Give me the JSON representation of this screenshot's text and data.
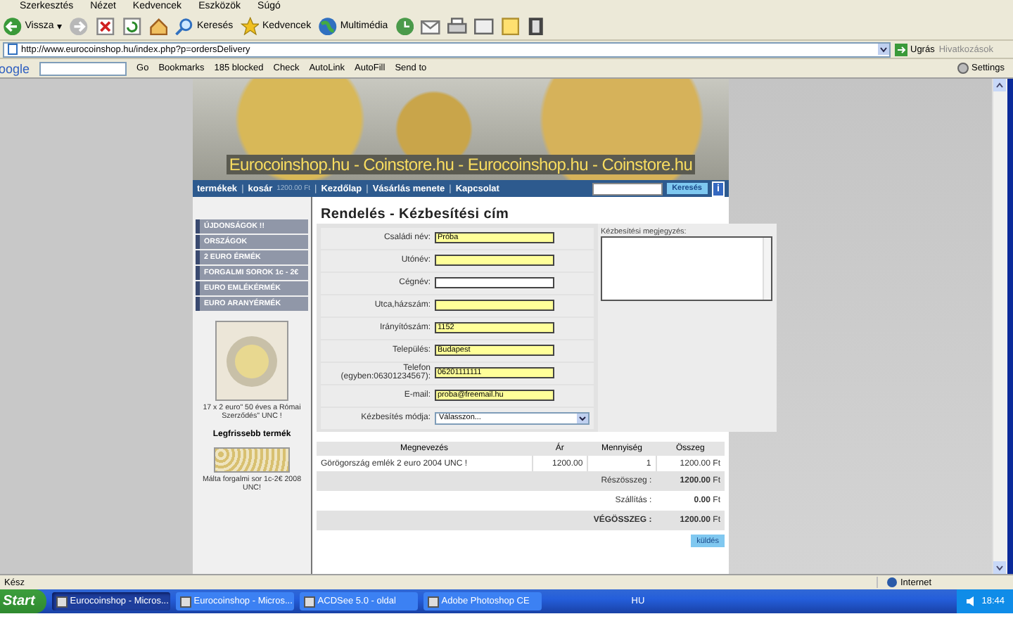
{
  "menu_bar": {
    "items": [
      "Szerkesztés",
      "Nézet",
      "Kedvencek",
      "Eszközök",
      "Súgó"
    ]
  },
  "toolbar": {
    "back_label": "Vissza",
    "back_menu": "▾",
    "search_label": "Keresés",
    "favorites_label": "Kedvencek",
    "media_label": "Multimédia"
  },
  "address_bar": {
    "url": "http://www.eurocoinshop.hu/index.php?p=ordersDelivery",
    "go_label": "Ugrás",
    "links_label": "Hivatkozások"
  },
  "google_bar": {
    "logo": "oogle",
    "go_label": "Go",
    "items": [
      "Bookmarks",
      "185 blocked",
      "Check",
      "AutoLink",
      "AutoFill",
      "Send to"
    ],
    "settings_label": "Settings"
  },
  "banner": {
    "text": "Eurocoinshop.hu - Coinstore.hu - Eurocoinshop.hu - Coinstore.hu"
  },
  "nav": {
    "links": [
      "termékek",
      "kosár",
      "Kezdőlap",
      "Vásárlás menete",
      "Kapcsolat"
    ],
    "separator": "|",
    "cart_amount": "1200.00 Ft",
    "search_button": "Keresés",
    "info": "i"
  },
  "sidebar": {
    "categories": [
      "ÚJDONSÁGOK !!",
      "ORSZÁGOK",
      "2 EURO ÉRMÉK",
      "FORGALMI SOROK 1c - 2€",
      "EURO EMLÉKÉRMÉK",
      "EURO ARANYÉRMÉK"
    ],
    "featured_caption": "17 x 2 euro\" 50 éves a Római Szerződés\" UNC !",
    "latest_heading": "Legfrissebb termék",
    "latest_caption": "Málta forgalmi sor 1c-2€ 2008 UNC!"
  },
  "form": {
    "title": "Rendelés - Kézbesítési cím",
    "fields": [
      {
        "label": "Családi név:",
        "value": "Próba",
        "kind": "text",
        "highlighted": true
      },
      {
        "label": "Utónév:",
        "kind": "text",
        "highlighted": true
      },
      {
        "label": "Cégnév:",
        "kind": "text",
        "highlighted": false
      },
      {
        "label": "Utca,házszám:",
        "kind": "text",
        "highlighted": true
      },
      {
        "label": "Irányítószám:",
        "value": "1152",
        "kind": "text",
        "highlighted": true
      },
      {
        "label": "Település:",
        "value": "Budapest",
        "kind": "text",
        "highlighted": true
      },
      {
        "label": "Telefon (egyben:06301234567):",
        "value": "06201111111",
        "kind": "text",
        "highlighted": true
      },
      {
        "label": "E-mail:",
        "value": "proba@freemail.hu",
        "kind": "text",
        "highlighted": true
      },
      {
        "label": "Kézbesítés módja:",
        "value": "Válasszon...",
        "kind": "select"
      }
    ],
    "note_label": "Kézbesítési megjegyzés:"
  },
  "order_table": {
    "columns": [
      "Megnevezés",
      "Ár",
      "Mennyiség",
      "Összeg"
    ],
    "rows": [
      {
        "name": "Görögország emlék 2 euro 2004 UNC !",
        "price": "1200.00",
        "quantity": "1",
        "total": "1200.00",
        "currency": "Ft"
      }
    ],
    "summary": [
      {
        "label": "Részösszeg :",
        "value": "1200.00",
        "currency": "Ft",
        "kind": "shaded"
      },
      {
        "label": "Szállítás :",
        "value": "0.00",
        "currency": "Ft",
        "kind": "plain"
      },
      {
        "label": "VÉGÖSSZEG :",
        "value": "1200.00",
        "currency": "Ft",
        "kind": "total"
      }
    ],
    "submit": "küldés"
  },
  "status_bar": {
    "text": "Kész",
    "zone": "Internet"
  },
  "taskbar": {
    "start": "Start",
    "tasks": [
      {
        "label": "Eurocoinshop - Micros...",
        "selected": true
      },
      {
        "label": "Eurocoinshop - Micros...",
        "selected": false
      },
      {
        "label": "ACDSee 5.0 - oldal",
        "selected": false
      },
      {
        "label": "Adobe Photoshop CE",
        "selected": false
      }
    ],
    "language": "HU",
    "clock": "18:44"
  }
}
